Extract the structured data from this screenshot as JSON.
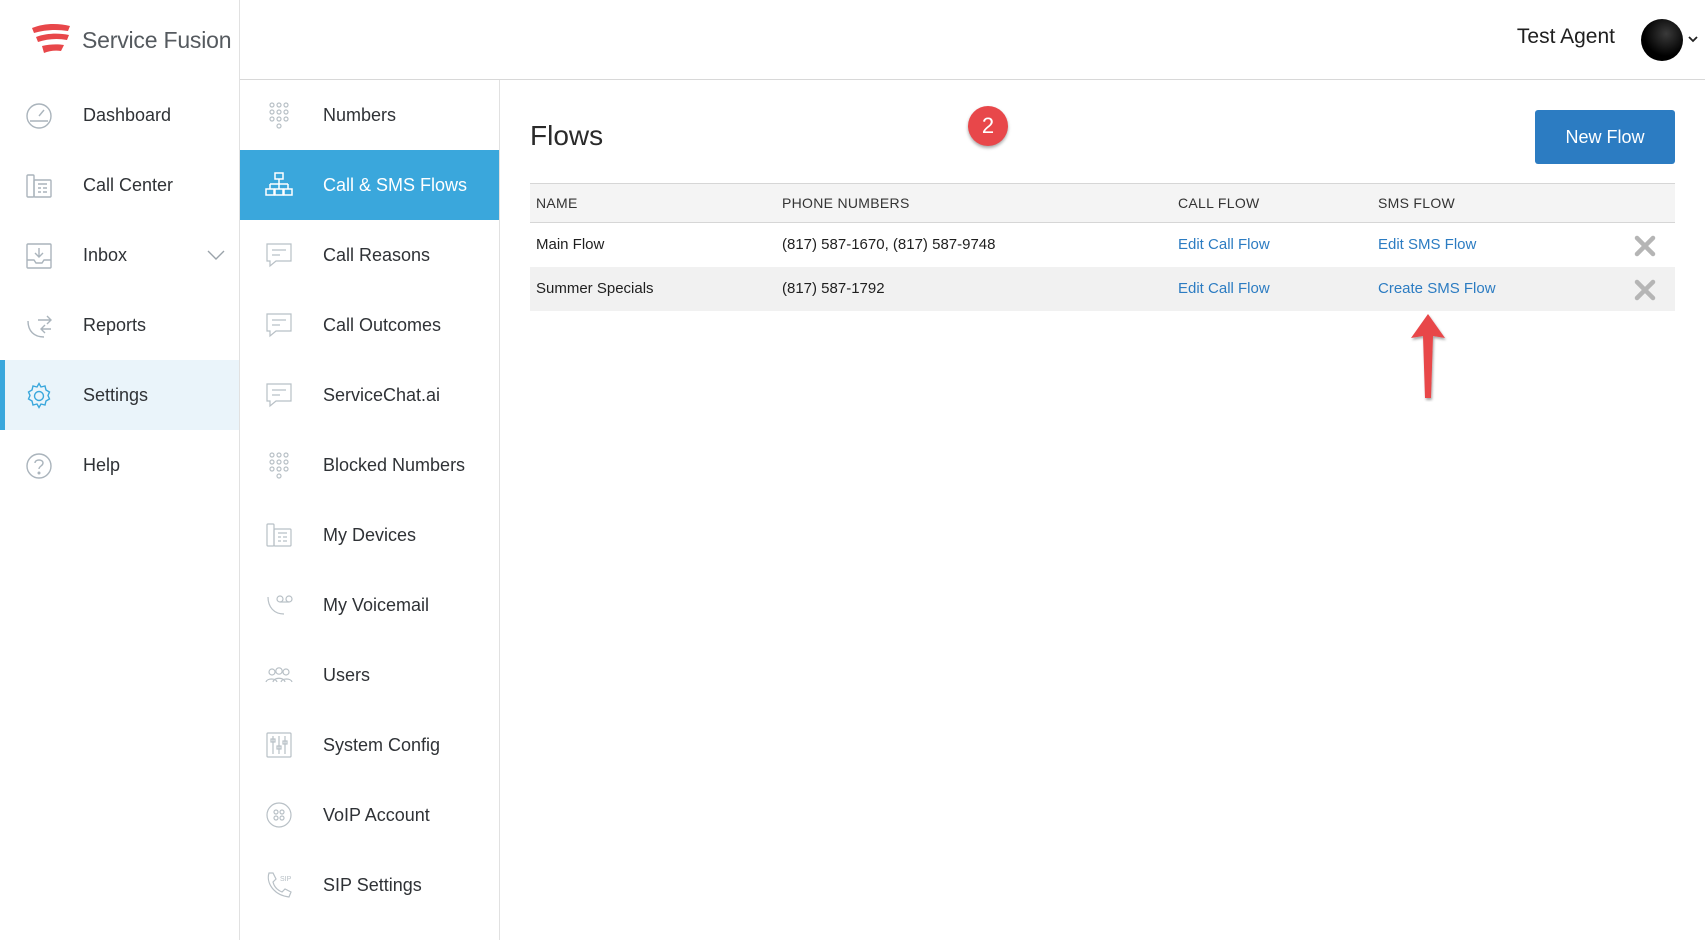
{
  "brand": {
    "name": "Service Fusion",
    "accent": "#3aa7dc",
    "logo_color": "#e8474a"
  },
  "header": {
    "user_name": "Test Agent"
  },
  "sidebar": {
    "items": [
      {
        "label": "Dashboard",
        "icon": "dashboard-gauge-icon"
      },
      {
        "label": "Call Center",
        "icon": "call-center-phone-icon"
      },
      {
        "label": "Inbox",
        "icon": "inbox-tray-icon",
        "expandable": true
      },
      {
        "label": "Reports",
        "icon": "reports-arrows-icon"
      },
      {
        "label": "Settings",
        "icon": "gear-icon",
        "active": true
      },
      {
        "label": "Help",
        "icon": "help-question-icon"
      }
    ]
  },
  "subnav": {
    "items": [
      {
        "label": "Numbers",
        "icon": "keypad-icon"
      },
      {
        "label": "Call & SMS Flows",
        "icon": "flow-hierarchy-icon",
        "active": true
      },
      {
        "label": "Call Reasons",
        "icon": "chat-bubble-icon"
      },
      {
        "label": "Call Outcomes",
        "icon": "chat-bubble-icon"
      },
      {
        "label": "ServiceChat.ai",
        "icon": "chat-bubble-icon"
      },
      {
        "label": "Blocked Numbers",
        "icon": "keypad-icon"
      },
      {
        "label": "My Devices",
        "icon": "desk-phone-icon"
      },
      {
        "label": "My Voicemail",
        "icon": "voicemail-icon"
      },
      {
        "label": "Users",
        "icon": "users-group-icon"
      },
      {
        "label": "System Config",
        "icon": "sliders-icon"
      },
      {
        "label": "VoIP Account",
        "icon": "voip-dots-icon"
      },
      {
        "label": "SIP Settings",
        "icon": "sip-phone-icon"
      }
    ]
  },
  "main": {
    "title": "Flows",
    "step_badge": "2",
    "new_flow_label": "New Flow",
    "columns": [
      "NAME",
      "PHONE NUMBERS",
      "CALL FLOW",
      "SMS FLOW"
    ],
    "rows": [
      {
        "name": "Main Flow",
        "phones": "(817) 587-1670, (817) 587-9748",
        "call_flow": "Edit Call Flow",
        "sms_flow": "Edit SMS Flow"
      },
      {
        "name": "Summer Specials",
        "phones": "(817) 587-1792",
        "call_flow": "Edit Call Flow",
        "sms_flow": "Create SMS Flow"
      }
    ]
  }
}
